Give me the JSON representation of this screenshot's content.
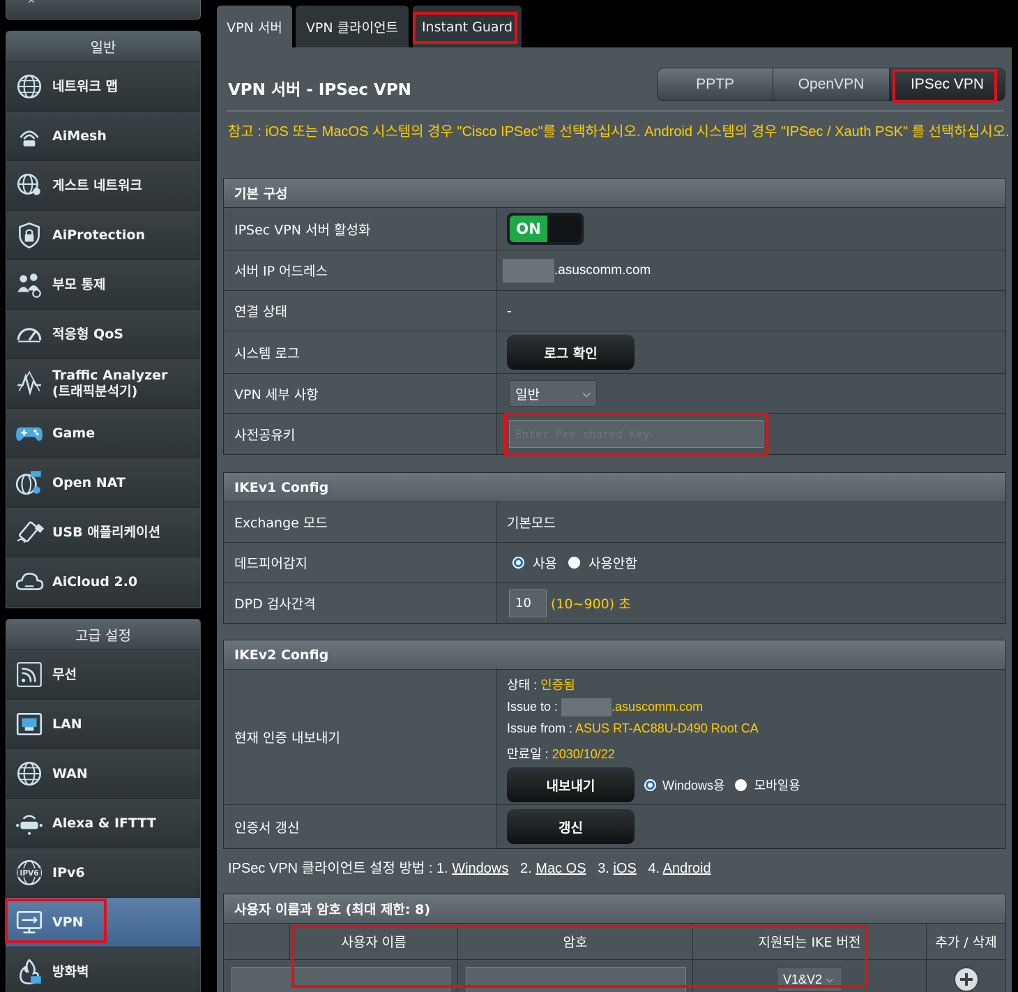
{
  "sidebar": {
    "general_header": "일반",
    "general_items": [
      {
        "label": "네트워크 맵",
        "icon": "network-map-icon"
      },
      {
        "label": "AiMesh",
        "icon": "aimesh-icon"
      },
      {
        "label": "게스트 네트워크",
        "icon": "guest-network-icon"
      },
      {
        "label": "AiProtection",
        "icon": "shield-lock-icon"
      },
      {
        "label": "부모 통제",
        "icon": "parental-control-icon"
      },
      {
        "label": "적응형 QoS",
        "icon": "gauge-icon"
      },
      {
        "label": "Traffic Analyzer",
        "label2": "(트래픽분석기)",
        "icon": "traffic-analyzer-icon"
      },
      {
        "label": "Game",
        "icon": "gamepad-icon"
      },
      {
        "label": "Open NAT",
        "icon": "open-nat-icon"
      },
      {
        "label": "USB 애플리케이션",
        "icon": "usb-icon"
      },
      {
        "label": "AiCloud 2.0",
        "icon": "cloud-icon"
      }
    ],
    "advanced_header": "고급 설정",
    "advanced_items": [
      {
        "label": "무선",
        "icon": "wireless-icon"
      },
      {
        "label": "LAN",
        "icon": "lan-icon"
      },
      {
        "label": "WAN",
        "icon": "globe-icon"
      },
      {
        "label": "Alexa & IFTTT",
        "icon": "alexa-icon"
      },
      {
        "label": "IPv6",
        "icon": "ipv6-icon"
      },
      {
        "label": "VPN",
        "icon": "vpn-icon",
        "active": true
      },
      {
        "label": "방화벽",
        "icon": "firewall-icon"
      }
    ]
  },
  "tabs": [
    "VPN 서버",
    "VPN 클라이언트",
    "Instant Guard"
  ],
  "page_title": "VPN 서버 - IPSec VPN",
  "protocol_tabs": [
    "PPTP",
    "OpenVPN",
    "IPSec VPN"
  ],
  "note": "참고 : iOS 또는 MacOS 시스템의 경우 \"Cisco IPSec\"를 선택하십시오. Android 시스템의 경우 \"IPSec / Xauth PSK\" 를 선택하십시오.",
  "basic": {
    "header": "기본 구성",
    "enable_label": "IPSec VPN 서버 활성화",
    "enable_value": "ON",
    "server_ip_label": "서버 IP 어드레스",
    "server_ip_suffix": ".asuscomm.com",
    "conn_state_label": "연결 상태",
    "conn_state_value": "-",
    "syslog_label": "시스템 로그",
    "syslog_button": "로그 확인",
    "detail_label": "VPN 세부 사항",
    "detail_value": "일반",
    "psk_label": "사전공유키",
    "psk_placeholder": "Enter Pre-shared Key"
  },
  "ikev1": {
    "header": "IKEv1 Config",
    "exchange_label": "Exchange 모드",
    "exchange_value": "기본모드",
    "dpd_label": "데드피어감지",
    "dpd_on": "사용",
    "dpd_off": "사용안함",
    "interval_label": "DPD 검사간격",
    "interval_value": "10",
    "interval_hint": "(10~900) 초"
  },
  "ikev2": {
    "header": "IKEv2 Config",
    "export_label": "현재 인증 내보내기",
    "status_key": "상태 : ",
    "status_value": "인증됨",
    "issue_to_key": "Issue to : ",
    "issue_to_suffix": ".asuscomm.com",
    "issue_from_key": "Issue from : ",
    "issue_from_value": "ASUS RT-AC88U-D490 Root CA",
    "expiry_key": "만료일 : ",
    "expiry_value": "2030/10/22",
    "export_button": "내보내기",
    "opt_windows": "Windows용",
    "opt_mobile": "모바일용",
    "renew_label": "인증서 갱신",
    "renew_button": "갱신"
  },
  "howto": {
    "prefix": "IPSec VPN 클라이언트 설정 방법 : ",
    "n1": "1. ",
    "l1": "Windows",
    "n2": "2. ",
    "l2": "Mac OS",
    "n3": "3. ",
    "l3": "iOS",
    "n4": "4. ",
    "l4": "Android"
  },
  "users": {
    "header": "사용자 이름과 암호 (최대 제한: 8)",
    "col_user": "사용자 이름",
    "col_pass": "암호",
    "col_ike": "지원되는 IKE 버전",
    "col_action": "추가 / 삭제",
    "ike_value": "V1&V2"
  },
  "colors": {
    "accent_red": "#e0101a",
    "note_yellow": "#ffcc00",
    "toggle_green": "#1fa84a",
    "active_blue": "#4d74a0"
  }
}
